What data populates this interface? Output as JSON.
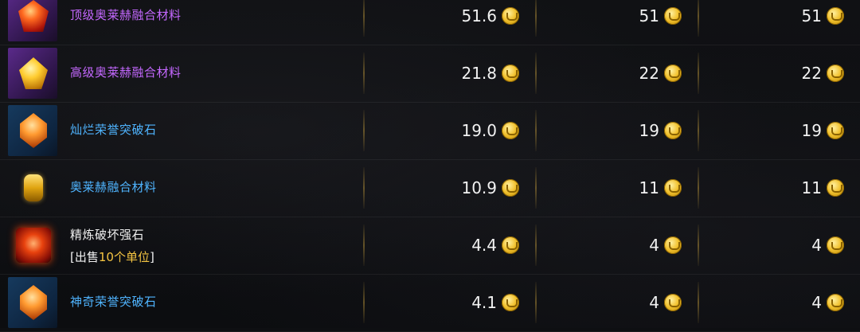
{
  "colors": {
    "purple_name": "#c468ff",
    "blue_name": "#4fb4ff",
    "white_name": "#f0f0f0",
    "highlight": "#f5c542",
    "price_text": "#f2f2f2"
  },
  "items": [
    {
      "name": "顶级奥莱赫融合材料",
      "icon": "red-gem-icon",
      "name_color": "purple",
      "prices": [
        "51.6",
        "51",
        "51"
      ]
    },
    {
      "name": "高级奥莱赫融合材料",
      "icon": "gold-gem-icon",
      "name_color": "purple",
      "prices": [
        "21.8",
        "22",
        "22"
      ]
    },
    {
      "name": "灿烂荣誉突破石",
      "icon": "amber-crystal-icon",
      "name_color": "blue",
      "prices": [
        "19.0",
        "19",
        "19"
      ]
    },
    {
      "name": "奥莱赫融合材料",
      "icon": "gold-capsule-icon",
      "name_color": "blue",
      "prices": [
        "10.9",
        "11",
        "11"
      ]
    },
    {
      "name": "精炼破坏强石",
      "icon": "red-square-gem-icon",
      "name_color": "white",
      "note_prefix": "[出售",
      "note_highlight": "10个单位",
      "note_suffix": "]",
      "prices": [
        "4.4",
        "4",
        "4"
      ]
    },
    {
      "name": "神奇荣誉突破石",
      "icon": "amber-crystal-icon",
      "name_color": "blue",
      "prices": [
        "4.1",
        "4",
        "4"
      ]
    }
  ],
  "currency_icon": "gold-coin-icon"
}
